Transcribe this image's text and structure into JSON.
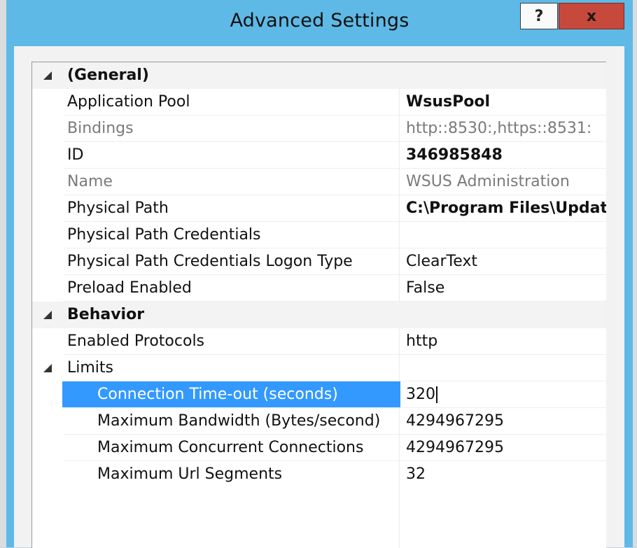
{
  "window": {
    "title": "Advanced Settings",
    "help_label": "?",
    "close_label": "x"
  },
  "sections": {
    "general": {
      "label": "(General)",
      "rows": [
        {
          "name": "Application Pool",
          "value": "WsusPool"
        },
        {
          "name": "Bindings",
          "value": "http::8530:,https::8531:"
        },
        {
          "name": "ID",
          "value": "346985848"
        },
        {
          "name": "Name",
          "value": "WSUS Administration"
        },
        {
          "name": "Physical Path",
          "value": "C:\\Program Files\\Update S"
        },
        {
          "name": "Physical Path Credentials",
          "value": ""
        },
        {
          "name": "Physical Path Credentials Logon Type",
          "value": "ClearText"
        },
        {
          "name": "Preload Enabled",
          "value": "False"
        }
      ]
    },
    "behavior": {
      "label": "Behavior",
      "rows": [
        {
          "name": "Enabled Protocols",
          "value": "http"
        }
      ]
    },
    "limits": {
      "label": "Limits",
      "rows": [
        {
          "name": "Connection Time-out (seconds)",
          "value": "320"
        },
        {
          "name": "Maximum Bandwidth (Bytes/second)",
          "value": "4294967295"
        },
        {
          "name": "Maximum Concurrent Connections",
          "value": "4294967295"
        },
        {
          "name": "Maximum Url Segments",
          "value": "32"
        }
      ]
    }
  },
  "colors": {
    "titlebar": "#5fb9e6",
    "selection": "#3399ff",
    "close_button": "#c7493b"
  },
  "icons": {
    "expand": "collapse-triangle-icon"
  }
}
